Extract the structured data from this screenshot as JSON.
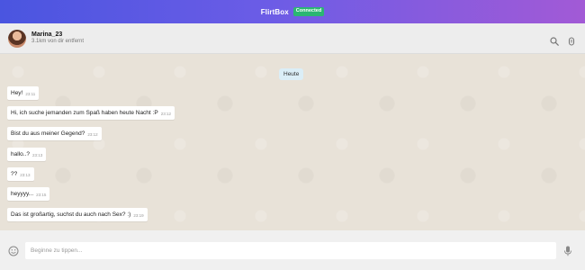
{
  "app": {
    "brand": "FlirtBox",
    "status": "Connected",
    "brand_gradient": [
      "#4a55e0",
      "#a25ad6"
    ],
    "status_color": "#2bb673"
  },
  "contact": {
    "name": "Marina_23",
    "distance": "3.1km von dir entfernt",
    "avatar_icon": "avatar-photo"
  },
  "header_icons": [
    "search-icon",
    "attachment-icon"
  ],
  "chat": {
    "date_badge": "Heute",
    "messages": [
      {
        "text": "Hey!",
        "time": "23:11"
      },
      {
        "text": "Hi, ich suche jemanden zum Spaß haben heute Nacht :P",
        "time": "23:12"
      },
      {
        "text": "Bist du aus meiner Gegend?",
        "time": "23:12"
      },
      {
        "text": "hallo..?",
        "time": "23:13"
      },
      {
        "text": "??",
        "time": "23:13"
      },
      {
        "text": "heyyyy...",
        "time": "23:15"
      },
      {
        "text": "Das ist großartig, suchst du auch nach Sex? :)",
        "time": "23:19"
      }
    ]
  },
  "composer": {
    "placeholder": "Beginne zu tippen...",
    "emoji_icon": "emoji-icon",
    "mic_icon": "microphone-icon"
  }
}
